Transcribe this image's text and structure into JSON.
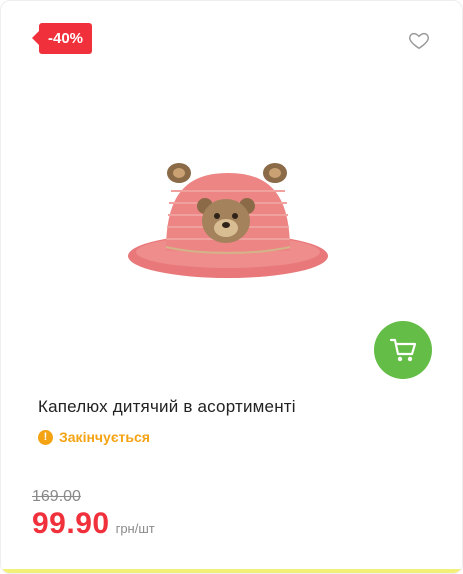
{
  "badge": {
    "discount": "-40%"
  },
  "icons": {
    "wishlist": "heart-outline-icon",
    "cart": "shopping-cart-icon",
    "stock": "exclamation-circle-icon"
  },
  "product": {
    "name": "Капелюх дитячий в асортименті",
    "image_alt": "pink-straw-hat-with-bear"
  },
  "stock": {
    "label": "Закінчується"
  },
  "price": {
    "old": "169.00",
    "current": "99.90",
    "unit": "грн/шт"
  },
  "colors": {
    "discount": "#f0303a",
    "cart": "#63bd46",
    "warning": "#f4a313"
  }
}
